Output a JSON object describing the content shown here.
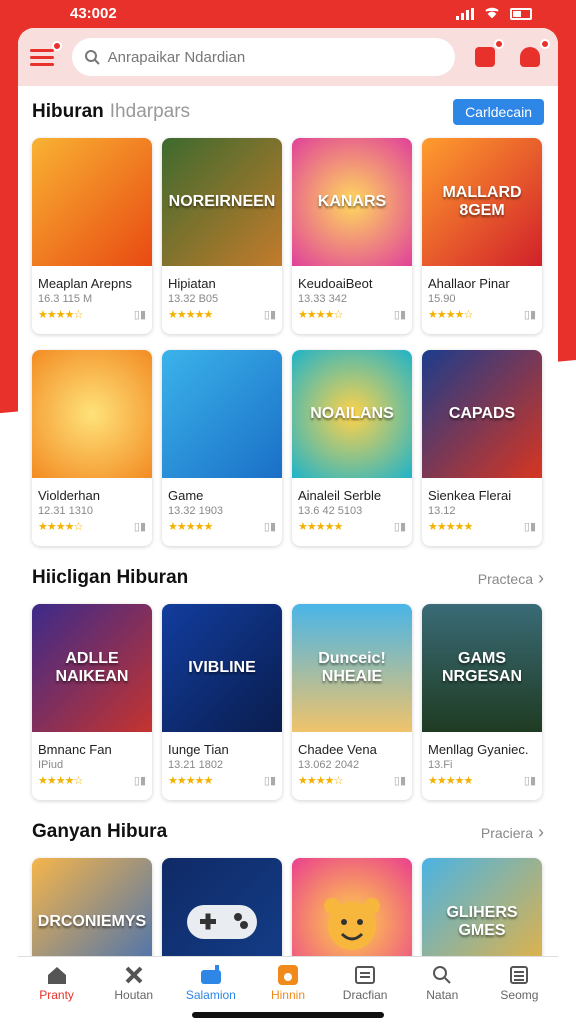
{
  "status": {
    "time": "43:002"
  },
  "search": {
    "placeholder": "Anrapaikar Ndardian"
  },
  "section1": {
    "title": "Hiburan",
    "subtitle": "Ihdarpars",
    "button_label": "Carldecain",
    "apps": [
      {
        "name": "Meaplan Arepns",
        "meta": "16.3 115 M",
        "thumb": "",
        "stars": 4
      },
      {
        "name": "Hipiatan",
        "meta": "13.32 B05",
        "thumb": "NOREIRNEEN",
        "stars": 5
      },
      {
        "name": "KeudoaiBeot",
        "meta": "13.33 342",
        "thumb": "KANARS",
        "stars": 4
      },
      {
        "name": "Ahallaor Pinar",
        "meta": "15.90",
        "thumb": "MALLARD 8GEM",
        "stars": 4
      },
      {
        "name": "Violderhan",
        "meta": "12.31 1310",
        "thumb": "",
        "stars": 4
      },
      {
        "name": "Game",
        "meta": "13.32 1903",
        "thumb": "",
        "stars": 5
      },
      {
        "name": "Ainaleil Serble",
        "meta": "13.6 42 5103",
        "thumb": "NOAILANS",
        "stars": 5
      },
      {
        "name": "Sienkea Flerai",
        "meta": "13.12",
        "thumb": "CAPADS",
        "stars": 5
      }
    ]
  },
  "section2": {
    "title": "Hiicligan Hiburan",
    "more": "Practeca",
    "apps": [
      {
        "name": "Bmnanc Fan",
        "meta": "IPiud",
        "thumb": "ADLLE NAIKEAN",
        "stars": 4
      },
      {
        "name": "Iunge Tian",
        "meta": "13.21 1802",
        "thumb": "IVIBLINE",
        "stars": 5
      },
      {
        "name": "Chadee Vena",
        "meta": "13.062 2042",
        "thumb": "Dunceic! NHEAIE",
        "stars": 4
      },
      {
        "name": "Menllag Gyaniec.",
        "meta": "13.Fi",
        "thumb": "GAMS NRGESAN",
        "stars": 5
      }
    ]
  },
  "section3": {
    "title": "Ganyan Hibura",
    "more": "Praciera",
    "apps": [
      {
        "thumb": "DRCONIEMYS"
      },
      {
        "thumb": ""
      },
      {
        "thumb": ""
      },
      {
        "thumb": "GLIHERS GMES"
      }
    ]
  },
  "nav": [
    {
      "label": "Pranty",
      "icon": "home-icon"
    },
    {
      "label": "Houtan",
      "icon": "tools-icon"
    },
    {
      "label": "Salamion",
      "icon": "gamepad-icon"
    },
    {
      "label": "Hinnin",
      "icon": "app-icon"
    },
    {
      "label": "Dracfian",
      "icon": "chat-icon"
    },
    {
      "label": "Natan",
      "icon": "search-icon"
    },
    {
      "label": "Seomg",
      "icon": "list-icon"
    }
  ],
  "colors": {
    "accent": "#e8312b",
    "blue": "#2e86e6",
    "orange": "#f08a1c",
    "star": "#f3b100"
  }
}
